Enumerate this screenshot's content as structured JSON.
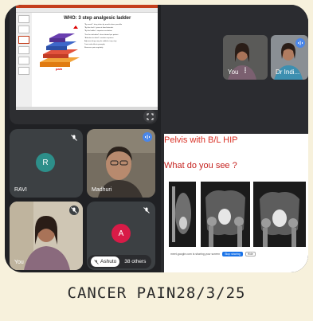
{
  "presentation": {
    "slide_title": "WHO: 3 step analgesic ladder",
    "slide_lines": [
      "\"By mouth\": drug taken by mouth where possible",
      "\"By the clock\": given at fixed intervals",
      "\"By the ladder\": stepwise escalation",
      "\"For the individual\": dose titrated per patient",
      "\"Attention to detail\": monitor response",
      "Adjuvant drugs may be added at any step",
      "Treat side effects promptly",
      "Reassess pain regularly"
    ],
    "logo_text": "pain"
  },
  "participants": [
    {
      "name": "RAVI",
      "initial": "R",
      "avatar_color": "#2d8f8a",
      "muted": true
    },
    {
      "name": "Madhuri",
      "muted": false
    },
    {
      "name": "You",
      "muted": true
    },
    {
      "name": "Ashuto",
      "initial": "A",
      "avatar_color": "#d81b47",
      "muted": true
    }
  ],
  "others_count": "38 others",
  "right_pane": {
    "pips": [
      {
        "name": "You"
      },
      {
        "name": "Dr Indi..."
      }
    ],
    "share": {
      "heading": "Pelvis with B/L HIP",
      "question": "What do you see ?",
      "bar_text": "meet.google.com is sharing your screen",
      "stop_label": "Stop sharing",
      "hide_label": "Hide"
    }
  },
  "caption": "CANCER PAIN28/3/25",
  "colors": {
    "accent_blue": "#4a86e8",
    "heading_red": "#d93025"
  }
}
